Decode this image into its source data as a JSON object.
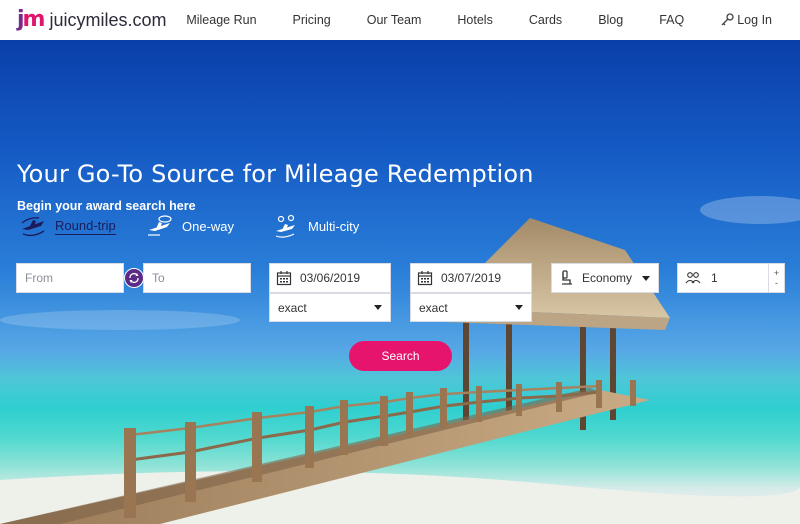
{
  "brand": {
    "mark": "jm",
    "name": "juicymiles.com"
  },
  "nav": {
    "items": [
      "Mileage Run",
      "Pricing",
      "Our Team",
      "Hotels",
      "Cards",
      "Blog",
      "FAQ"
    ],
    "login": "Log In"
  },
  "hero": {
    "title": "Your Go-To Source for Mileage Redemption",
    "subtitle": "Begin your award search here"
  },
  "trip_types": [
    {
      "label": "Round-trip",
      "icon": "round-trip-plane-icon",
      "active": true
    },
    {
      "label": "One-way",
      "icon": "one-way-plane-icon",
      "active": false
    },
    {
      "label": "Multi-city",
      "icon": "multi-city-plane-icon",
      "active": false
    }
  ],
  "form": {
    "from_placeholder": "From",
    "to_placeholder": "To",
    "depart_date": "03/06/2019",
    "depart_flex": "exact",
    "return_date": "03/07/2019",
    "return_flex": "exact",
    "cabin": "Economy",
    "passengers": "1",
    "search_label": "Search",
    "stepper_plus": "+",
    "stepper_minus": "-"
  },
  "colors": {
    "accent": "#e6146d",
    "brand_purple": "#5b2a86",
    "nav_text": "#333333"
  }
}
